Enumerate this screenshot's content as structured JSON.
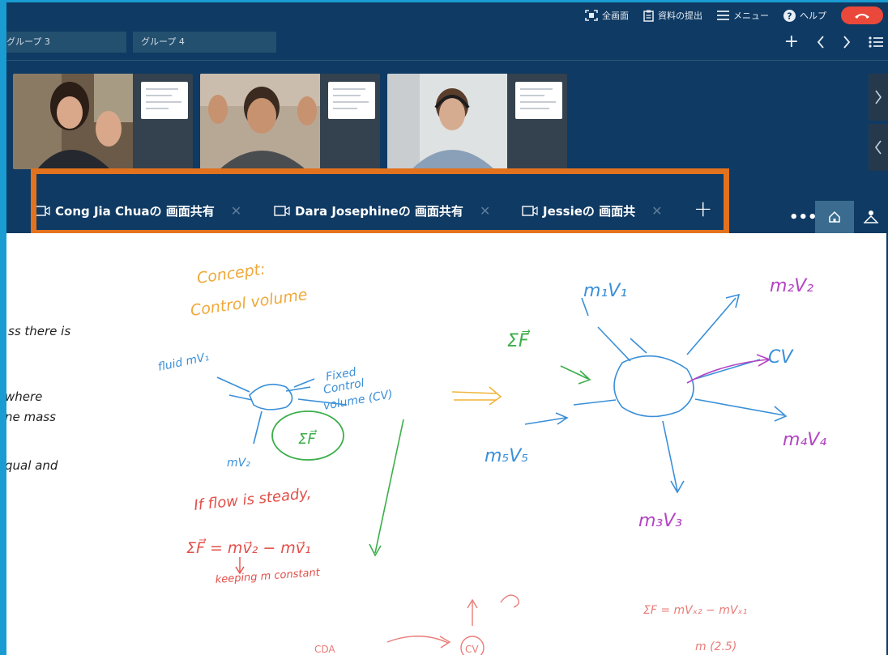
{
  "topbar": {
    "fullscreen_label": "全画面",
    "submit_label": "資料の提出",
    "menu_label": "メニュー",
    "help_label": "ヘルプ"
  },
  "groups": {
    "group3": "グループ 3",
    "group4": "グループ 4"
  },
  "share_tabs": [
    {
      "label": "Cong Jia Chuaの 画面共有"
    },
    {
      "label": "Dara Josephineの 画面共有"
    },
    {
      "label": "Jessieの 画面共"
    }
  ],
  "whiteboard": {
    "left_text": [
      "ss there is",
      "where",
      "ne mass",
      "qual and"
    ],
    "concept": [
      "Concept:",
      "Control volume"
    ],
    "fluid_in": "fluid mV₁",
    "fixed_cv": [
      "Fixed",
      "Control",
      "volume (CV)"
    ],
    "sum_f_circle": "ΣF⃗",
    "mv2": "mV₂",
    "steady_line1": "If flow is steady,",
    "steady_line2": "ΣF⃗ = mv⃗₂ − mv⃗₁",
    "steady_line3": "keeping m constant",
    "sum_f": "ΣF⃗",
    "m1v1": "m₁V₁",
    "m2v2": "m₂V₂",
    "cv_label": "CV",
    "m4v4": "m₄V₄",
    "m5v5": "m₅V₅",
    "m3v3": "m₃V₃",
    "bottom_eq": "ΣF = mVₓ₂ − mVₓ₁",
    "bottom_frag": "m (2.5)",
    "bottom_cv": "CV",
    "bottom_cda": "CDA"
  }
}
